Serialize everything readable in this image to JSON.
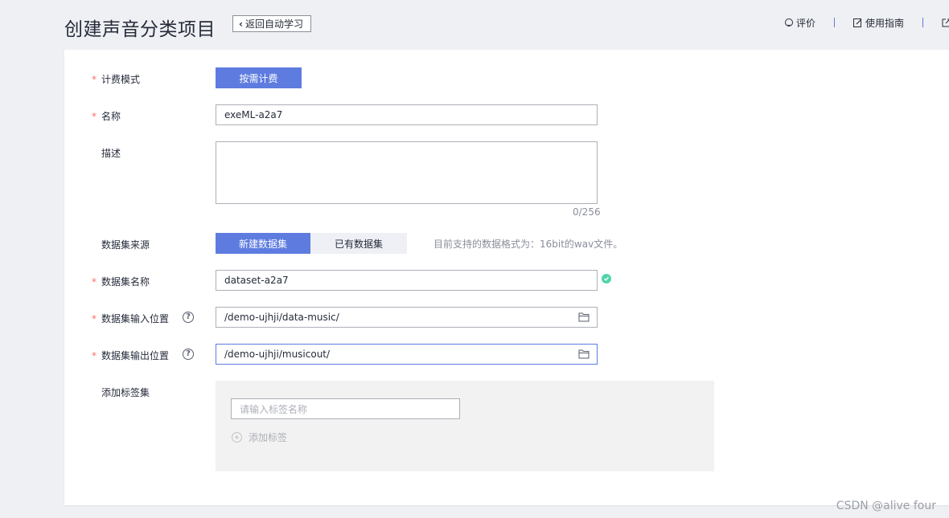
{
  "header": {
    "title": "创建声音分类项目",
    "back_label": "返回自动学习",
    "actions": {
      "review": "评价",
      "guide": "使用指南"
    }
  },
  "form": {
    "billing": {
      "label": "计费模式",
      "value": "按需计费"
    },
    "name": {
      "label": "名称",
      "value": "exeML-a2a7"
    },
    "description": {
      "label": "描述",
      "value": "",
      "counter": "0/256"
    },
    "dataset_source": {
      "label": "数据集来源",
      "option_new": "新建数据集",
      "option_existing": "已有数据集",
      "hint": "目前支持的数据格式为：16bit的wav文件。"
    },
    "dataset_name": {
      "label": "数据集名称",
      "value": "dataset-a2a7"
    },
    "input_location": {
      "label": "数据集输入位置",
      "value": "/demo-ujhji/data-music/"
    },
    "output_location": {
      "label": "数据集输出位置",
      "value": "/demo-ujhji/musicout/"
    },
    "labels": {
      "label": "添加标签集",
      "placeholder": "请输入标签名称",
      "add_label": "添加标签"
    }
  },
  "required_mark": "*",
  "watermark": "CSDN @alive four",
  "colors": {
    "primary": "#5e7ce0",
    "required": "#f66f6a",
    "success": "#50d4ab"
  }
}
